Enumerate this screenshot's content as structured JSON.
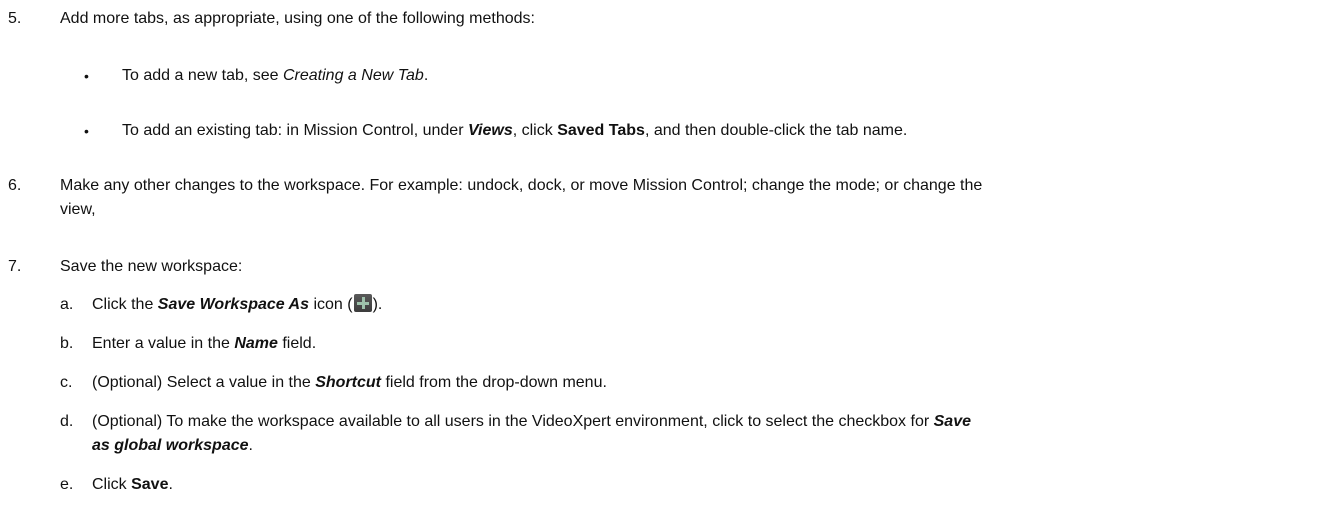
{
  "steps": {
    "s5": {
      "num": "5.",
      "text": "Add more tabs, as appropriate, using one of the following methods:",
      "bullets": [
        {
          "pre": "To add a new tab, see ",
          "link": "Creating a New Tab",
          "post": "."
        },
        {
          "pre": "To add an existing tab: in Mission Control, under ",
          "views": "Views",
          "mid": ", click ",
          "saved_tabs": "Saved Tabs",
          "post": ", and then double-click the tab name."
        }
      ]
    },
    "s6": {
      "num": "6.",
      "line1": "Make any other changes to the workspace. For example: undock, dock, or move Mission Control; change the mode; or change the",
      "line2": "view,"
    },
    "s7": {
      "num": "7.",
      "text": "Save the new workspace:",
      "a": {
        "letter": "a.",
        "pre": "Click the ",
        "term": "Save Workspace As",
        "mid": " icon (",
        "post": ")."
      },
      "b": {
        "letter": "b.",
        "pre": "Enter a value in the ",
        "term": "Name",
        "post": " field."
      },
      "c": {
        "letter": "c.",
        "pre": "(Optional) Select a value in the ",
        "term": "Shortcut",
        "post": " field from the drop-down menu."
      },
      "d": {
        "letter": "d.",
        "line1_pre": "(Optional) To make the workspace available to all users in the VideoXpert environment, click to select the checkbox for ",
        "term1": "Save",
        "term2": "as global workspace",
        "post": "."
      },
      "e": {
        "letter": "e.",
        "pre": "Click ",
        "term": "Save",
        "post": "."
      }
    }
  },
  "bullet_glyph": "•",
  "icons": {
    "save_workspace_as": "plus-icon"
  }
}
